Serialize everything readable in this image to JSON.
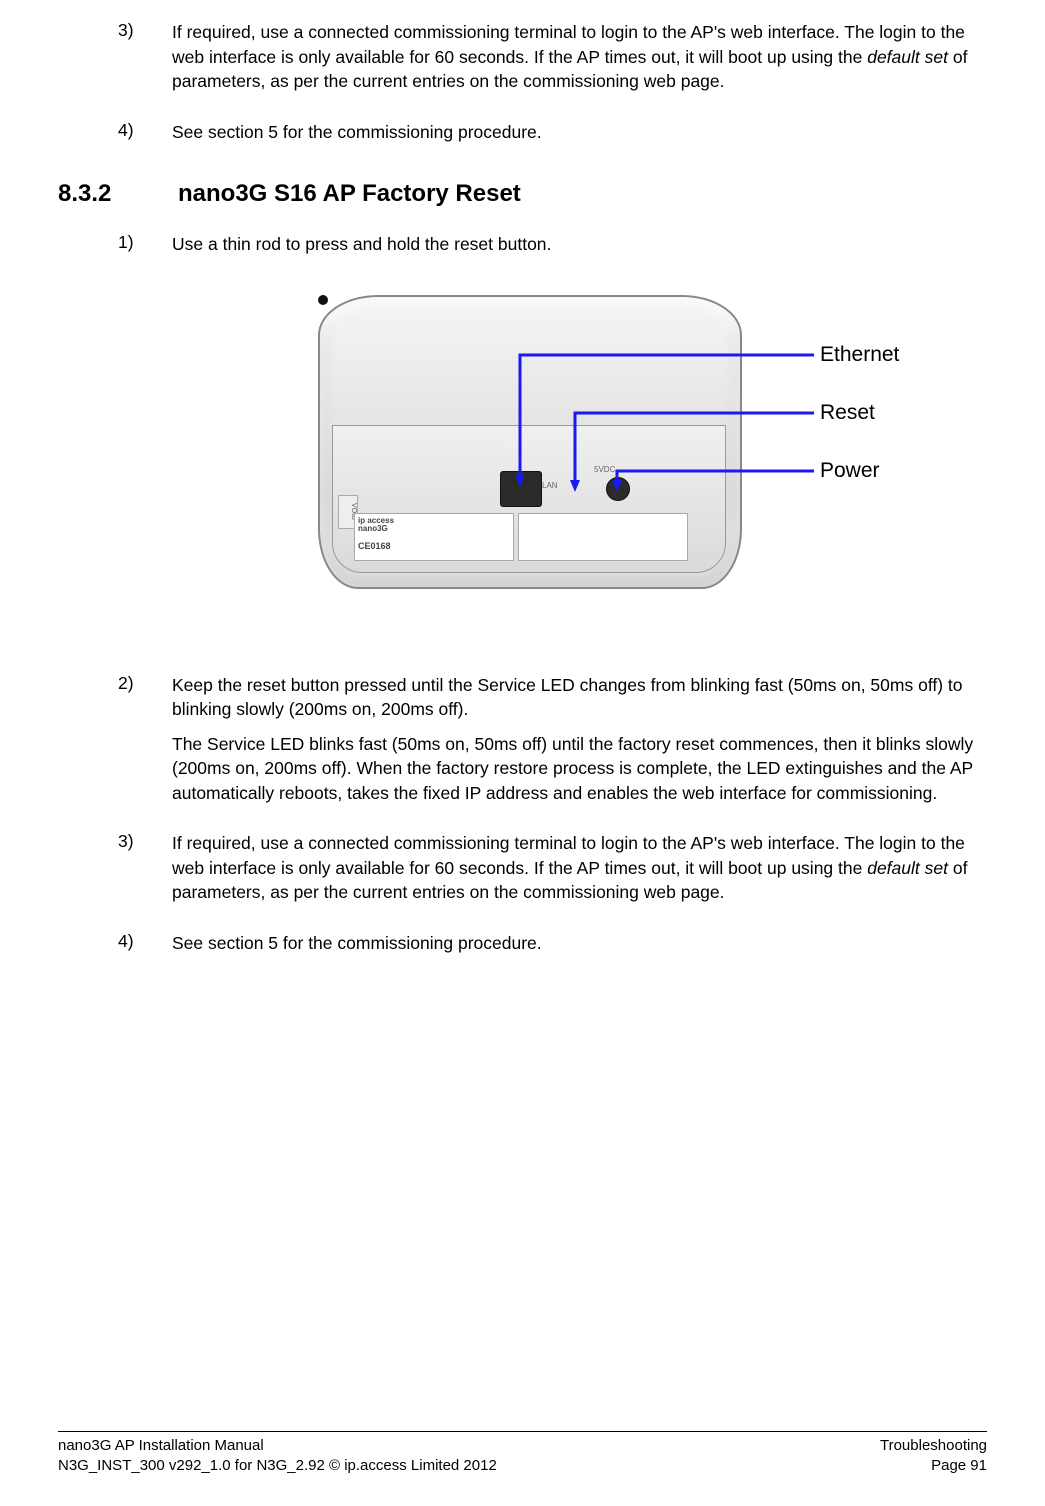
{
  "section1": {
    "items": [
      {
        "num": "3)",
        "paras": [
          {
            "runs": [
              {
                "t": "If required, use a connected commissioning terminal to login to the AP's web interface. The login to the web interface is only available for 60 seconds. If the AP times out, it will boot up using the "
              },
              {
                "t": "default set",
                "italic": true
              },
              {
                "t": " of parameters, as per the current entries on the commissioning web page."
              }
            ]
          }
        ]
      },
      {
        "num": "4)",
        "paras": [
          {
            "runs": [
              {
                "t": "See section 5 for the commissioning procedure."
              }
            ]
          }
        ]
      }
    ]
  },
  "heading": {
    "num": "8.3.2",
    "title": "nano3G S16 AP Factory Reset"
  },
  "section2": {
    "items": [
      {
        "num": "1)",
        "paras": [
          {
            "runs": [
              {
                "t": "Use a thin rod to press and hold the reset button."
              }
            ]
          }
        ]
      }
    ]
  },
  "figure": {
    "labels": {
      "ethernet": "Ethernet",
      "reset": "Reset",
      "power": "Power"
    },
    "sticker": {
      "brand_line": "ip access",
      "prod_line": "nano3G",
      "ce": "CE0168"
    },
    "void_text": "VOID",
    "lan_text": "LAN",
    "pwr_text": "5VDC"
  },
  "section3": {
    "items": [
      {
        "num": "2)",
        "paras": [
          {
            "runs": [
              {
                "t": "Keep the reset button pressed until the Service LED changes from blinking fast (50ms on, 50ms off) to blinking slowly (200ms on, 200ms off)."
              }
            ]
          },
          {
            "runs": [
              {
                "t": "The Service LED blinks fast (50ms on, 50ms off) until the factory reset commences, then it blinks slowly (200ms on, 200ms off). When the factory restore process is complete, the LED extinguishes and the AP automatically reboots, takes the fixed IP address and enables the web interface for commissioning."
              }
            ]
          }
        ]
      },
      {
        "num": "3)",
        "paras": [
          {
            "runs": [
              {
                "t": "If required, use a connected commissioning terminal to login to the AP's web interface. The login to the web interface is only available for 60 seconds. If the AP times out, it will boot up using the "
              },
              {
                "t": "default set",
                "italic": true
              },
              {
                "t": " of parameters, as per the current entries on the commissioning web page."
              }
            ]
          }
        ]
      },
      {
        "num": "4)",
        "paras": [
          {
            "runs": [
              {
                "t": "See section 5 for the commissioning procedure."
              }
            ]
          }
        ]
      }
    ]
  },
  "footer": {
    "left1": "nano3G AP Installation Manual",
    "right1": "Troubleshooting",
    "left2": "N3G_INST_300 v292_1.0 for N3G_2.92 © ip.access Limited 2012",
    "right2": "Page 91"
  }
}
